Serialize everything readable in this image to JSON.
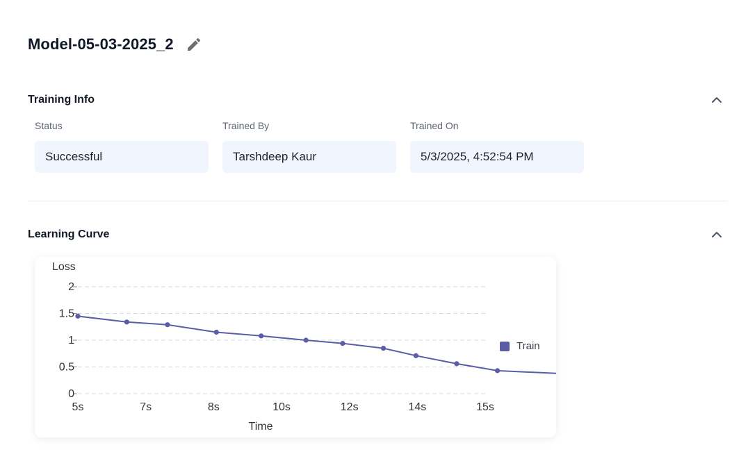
{
  "model": {
    "title": "Model-05-03-2025_2"
  },
  "icons": {
    "edit": "pencil-icon",
    "collapse": "chevron-up-icon"
  },
  "training_info": {
    "title": "Training Info",
    "fields": [
      {
        "label": "Status",
        "value": "Successful"
      },
      {
        "label": "Trained By",
        "value": "Tarshdeep Kaur"
      },
      {
        "label": "Trained On",
        "value": "5/3/2025, 4:52:54 PM"
      }
    ]
  },
  "learning_curve": {
    "title": "Learning Curve"
  },
  "colors": {
    "series": "#5b5ea6",
    "grid": "#d5d8de",
    "field_bg": "#f1f5fd"
  },
  "chart_data": {
    "type": "line",
    "xlabel": "Time",
    "ylabel": "Loss",
    "ylim": [
      0,
      2
    ],
    "yticks": [
      "0",
      "0.5",
      "1",
      "1.5",
      "2"
    ],
    "xlim": [
      5,
      15
    ],
    "xticks": [
      "5s",
      "7s",
      "8s",
      "10s",
      "12s",
      "14s",
      "15s"
    ],
    "grid": true,
    "legend_position": "right",
    "series": [
      {
        "name": "Train",
        "x": [
          5.0,
          6.2,
          7.2,
          8.4,
          9.5,
          10.6,
          11.5,
          12.5,
          13.3,
          14.3,
          15.3,
          17.6
        ],
        "y": [
          1.45,
          1.34,
          1.29,
          1.15,
          1.08,
          1.0,
          0.94,
          0.85,
          0.71,
          0.56,
          0.43,
          0.35
        ]
      }
    ]
  }
}
